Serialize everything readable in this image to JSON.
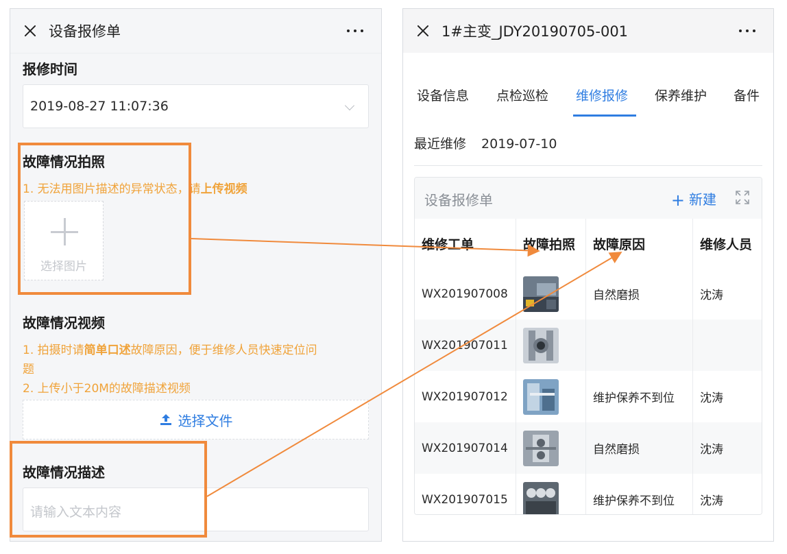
{
  "left": {
    "title": "设备报修单",
    "repair_time_label": "报修时间",
    "repair_time_value": "2019-08-27 11:07:36",
    "photo_label": "故障情况拍照",
    "photo_hint_prefix": "1. 无法用图片描述的异常状态，请",
    "photo_hint_bold": "上传视频",
    "photo_upload_label": "选择图片",
    "video_label": "故障情况视频",
    "video_hint1_prefix": "1. 拍摄时请",
    "video_hint1_bold": "简单口述",
    "video_hint1_suffix": "故障原因，便于维修人员快速定位问",
    "video_hint1_wrap": "题",
    "video_hint2": "2. 上传小于20M的故障描述视频",
    "file_button": "选择文件",
    "desc_label": "故障情况描述",
    "desc_placeholder": "请输入文本内容"
  },
  "right": {
    "title": "1#主变_JDY20190705-001",
    "tabs": [
      {
        "label": "设备信息",
        "active": false
      },
      {
        "label": "点检巡检",
        "active": false
      },
      {
        "label": "维修报修",
        "active": true
      },
      {
        "label": "保养维护",
        "active": false
      },
      {
        "label": "备件",
        "active": false
      }
    ],
    "recent_label": "最近维修",
    "recent_value": "2019-07-10",
    "card_title": "设备报修单",
    "new_button": "新建",
    "table": {
      "headers": [
        "维修工单",
        "故障拍照",
        "故障原因",
        "维修人员"
      ],
      "rows": [
        {
          "order": "WX201907008",
          "reason": "自然磨损",
          "person": "沈涛"
        },
        {
          "order": "WX201907011",
          "reason": "",
          "person": ""
        },
        {
          "order": "WX201907012",
          "reason": "维护保养不到位",
          "person": "沈涛"
        },
        {
          "order": "WX201907014",
          "reason": "自然磨损",
          "person": "沈涛"
        },
        {
          "order": "WX201907015",
          "reason": "维护保养不到位",
          "person": "沈涛"
        }
      ]
    }
  },
  "colors": {
    "accent": "#2f7de1",
    "hint": "#f0a33a",
    "highlight": "#f08a3c"
  }
}
